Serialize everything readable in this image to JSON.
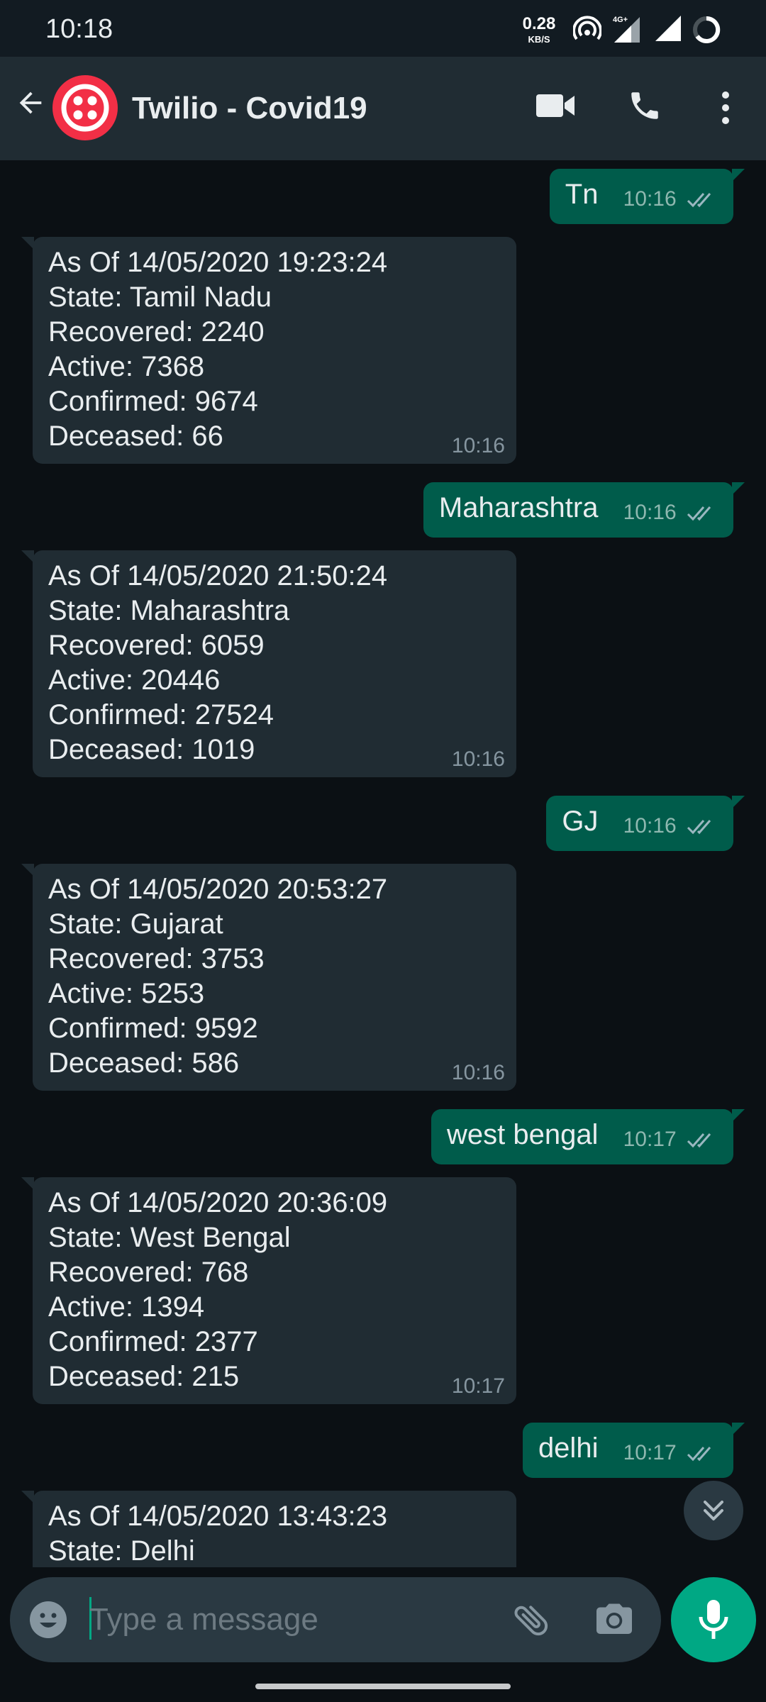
{
  "status_bar": {
    "time": "10:18",
    "net_rate_value": "0.28",
    "net_rate_unit": "KB/S",
    "network_type": "4G+"
  },
  "header": {
    "title": "Twilio - Covid19"
  },
  "messages": [
    {
      "direction": "out",
      "text": "Tn",
      "time": "10:16",
      "status": "read"
    },
    {
      "direction": "in",
      "lines": [
        "As Of 14/05/2020 19:23:24",
        "State: Tamil Nadu",
        "Recovered: 2240",
        "Active: 7368",
        "Confirmed: 9674",
        "Deceased: 66"
      ],
      "time": "10:16"
    },
    {
      "direction": "out",
      "text": "Maharashtra",
      "time": "10:16",
      "status": "read"
    },
    {
      "direction": "in",
      "lines": [
        "As Of 14/05/2020 21:50:24",
        "State: Maharashtra",
        "Recovered: 6059",
        "Active: 20446",
        "Confirmed: 27524",
        "Deceased: 1019"
      ],
      "time": "10:16"
    },
    {
      "direction": "out",
      "text": "GJ",
      "time": "10:16",
      "status": "read"
    },
    {
      "direction": "in",
      "lines": [
        "As Of 14/05/2020 20:53:27",
        "State: Gujarat",
        "Recovered: 3753",
        "Active: 5253",
        "Confirmed: 9592",
        "Deceased: 586"
      ],
      "time": "10:16"
    },
    {
      "direction": "out",
      "text": "west bengal",
      "time": "10:17",
      "status": "read"
    },
    {
      "direction": "in",
      "lines": [
        "As Of 14/05/2020 20:36:09",
        "State: West Bengal",
        "Recovered: 768",
        "Active: 1394",
        "Confirmed: 2377",
        "Deceased: 215"
      ],
      "time": "10:17"
    },
    {
      "direction": "out",
      "text": "delhi",
      "time": "10:17",
      "status": "read"
    },
    {
      "direction": "in",
      "lines": [
        "As Of 14/05/2020 13:43:23",
        "State: Delhi"
      ],
      "time": "",
      "partial": true
    }
  ],
  "composer": {
    "placeholder": "Type a message"
  },
  "colors": {
    "chat_background": "#0b1014",
    "header": "#202c33",
    "incoming_bubble": "#202c33",
    "outgoing_bubble": "#005c4b",
    "accent": "#00a884",
    "avatar": "#f22f46"
  },
  "icons": {
    "back": "arrow-left-icon",
    "video": "video-camera-icon",
    "phone": "phone-icon",
    "menu": "more-vertical-icon",
    "scroll": "double-chevron-down-icon",
    "emoji": "emoji-icon",
    "attach": "paperclip-icon",
    "camera": "camera-icon",
    "mic": "microphone-icon"
  }
}
